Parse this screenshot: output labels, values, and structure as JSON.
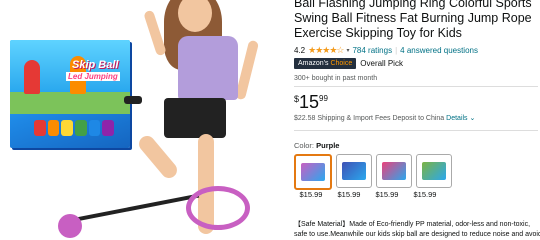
{
  "product": {
    "title_line1": "Ball Flashing Jumping Ring Colorful Sports",
    "title_line2": "Swing Ball Fitness Fat Burning Jump Rope",
    "title_line3": "Exercise Skipping Toy for Kids",
    "rating_value": "4.2",
    "rating_stars": "★★★★☆",
    "ratings_count": "784 ratings",
    "answered_questions": "4 answered questions",
    "badge_text": "Amazon's",
    "badge_accent": "Choice",
    "overall_pick": "Overall Pick",
    "bought_past_month": "300+ bought in past month",
    "price_currency": "$",
    "price_whole": "15",
    "price_fraction": "99",
    "import_text": "$22.58 Shipping & Import Fees Deposit to China",
    "details_link": "Details",
    "color_label": "Color:",
    "color_value": "Purple",
    "variant_prices": [
      "$15.99",
      "$15.99",
      "$15.99",
      "$15.99"
    ],
    "bullet_text": "【Safe Material】Made of Eco-friendly PP material, odor-less and non-toxic, safe to use.Meanwhile our kids skip ball are designed to reduce noise and avoid"
  },
  "image": {
    "box_title": "Skip Ball",
    "box_subtitle": "Led Jumping"
  },
  "colors": {
    "accent_orange": "#e47911",
    "link_teal": "#007185",
    "star_orange": "#f49b1c",
    "badge_dark": "#232f3e"
  }
}
